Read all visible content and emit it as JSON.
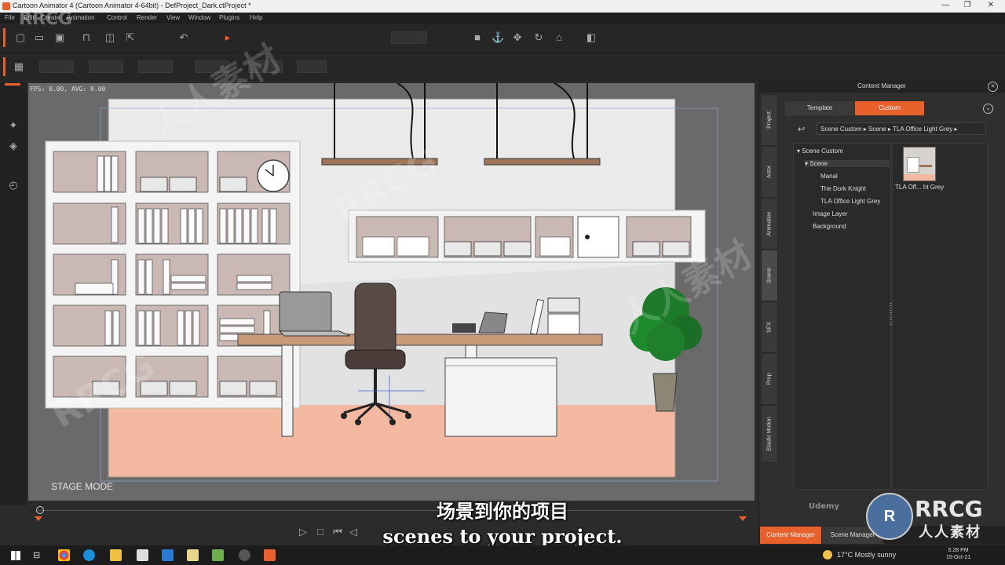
{
  "window": {
    "title": "Cartoon Animator 4  (Cartoon Animator 4-64bit) - DefProject_Dark.ctProject *",
    "minimize_glyph": "—",
    "maximize_glyph": "❐",
    "close_glyph": "✕"
  },
  "menu": [
    "File",
    "Edit",
    "Create",
    "Animation",
    "Control",
    "Render",
    "View",
    "Window",
    "Plugins",
    "Help"
  ],
  "viewport": {
    "fps_readout": "FPS: 0.00, AVG: 0.00",
    "mode_label": "STAGE MODE"
  },
  "content_manager": {
    "title": "Content Manager",
    "tabs": [
      "Template",
      "Custom"
    ],
    "active_tab": "Custom",
    "side_tabs": [
      "Project",
      "Actor",
      "Animation",
      "Scene",
      "SFX",
      "Prop",
      "Elastic Motion"
    ],
    "active_side_tab": "Scene",
    "breadcrumb": "Scene Custom ▸  Scene ▸  TLA Office Light Grey ▸",
    "tree": [
      {
        "label": "▾ Scene Custom",
        "level": 0
      },
      {
        "label": "▾ Scene",
        "level": 1
      },
      {
        "label": "Manal",
        "level": 2
      },
      {
        "label": "The Dork Knight",
        "level": 2
      },
      {
        "label": "TLA Office Light Grey",
        "level": 2
      },
      {
        "label": "Image Layer",
        "level": 1
      },
      {
        "label": "Background",
        "level": 1
      }
    ],
    "thumbnail_label": "TLA Off... ht Grey"
  },
  "bottom_tabs": [
    "Content Manager",
    "Scene Manager"
  ],
  "subtitles": {
    "chinese": "场景到你的项目",
    "english": "scenes to your project."
  },
  "taskbar": {
    "weather": "17°C  Mostly sunny",
    "time": "5:28 PM",
    "date": "15-Oct-21"
  },
  "watermark": {
    "text": "RRCG",
    "cn_text": "人人素材",
    "udemy": "Udemy"
  },
  "colors": {
    "accent": "#e8602c",
    "panel_bg": "#2f2f2f",
    "floor": "#f2b8a0",
    "wall": "#eaeaea",
    "shelf_bg": "#c9b8b3"
  }
}
